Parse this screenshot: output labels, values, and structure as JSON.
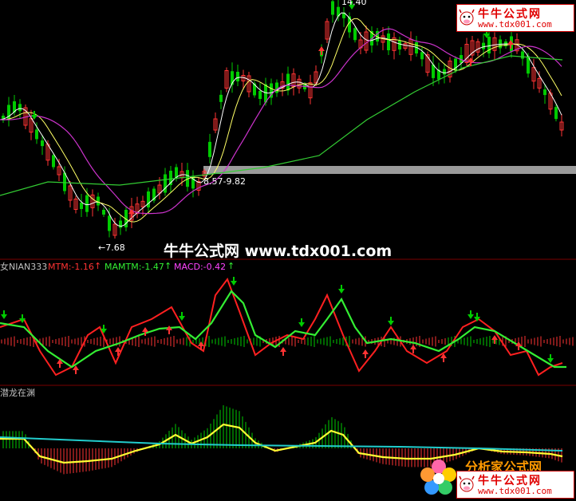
{
  "main_chart": {
    "labels": {
      "high_price": "14.40",
      "low_price": "←7.68",
      "range_text": "8.57-9.82"
    }
  },
  "watermark": {
    "text": "牛牛公式网 www.tdx001.com"
  },
  "indicator1": {
    "name": "女NIAN333",
    "mtm_label": "MTM:-1.16",
    "mamtm_label": "MAMTM:-1.47",
    "macd_label": "MACD:-0.42"
  },
  "indicator2": {
    "name": "潜龙在渊"
  },
  "logo_top": {
    "title": "牛牛公式网",
    "url": "www.tdx001.com"
  },
  "logo_bottom": {
    "brand": "分析家公式网",
    "title": "牛牛公式网",
    "url": "www.tdx001.com"
  },
  "colors": {
    "background": "#000000",
    "candle_up": "#ff3333",
    "candle_down": "#00cc00",
    "mtm_line": "#ff2020",
    "mamtm_line": "#33ee33",
    "ma_white": "#ffffff",
    "ma_yellow": "#ffff66",
    "ma_magenta": "#cc33cc",
    "ma_green": "#33cc33",
    "cyan_line": "#22cccc",
    "yellow_line": "#ffff33"
  }
}
